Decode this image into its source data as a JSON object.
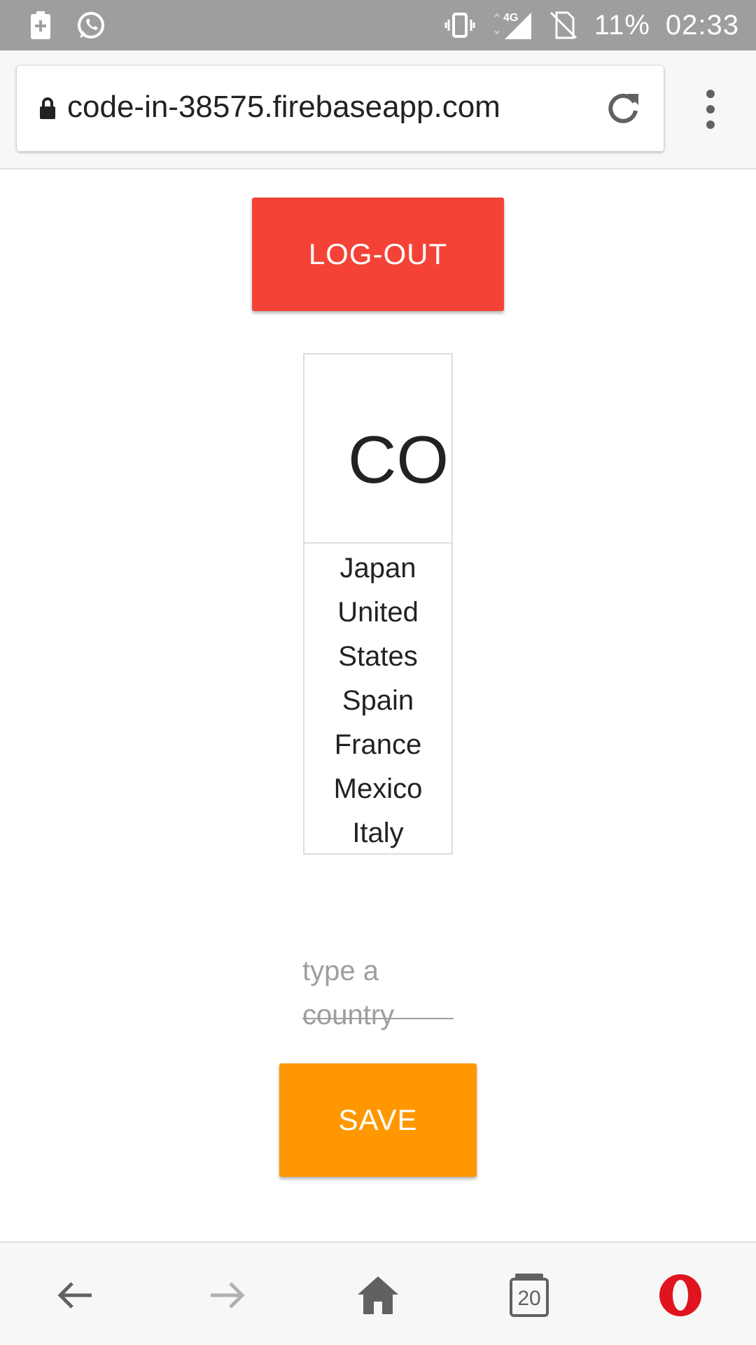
{
  "status_bar": {
    "battery": "11%",
    "time": "02:33",
    "network": "4G"
  },
  "address_bar": {
    "url": "code-in-38575.firebaseapp.com"
  },
  "content": {
    "logout_label": "LOG-OUT",
    "table_header": "COUNTRY",
    "countries": [
      "Japan",
      "United States",
      "Spain",
      "France",
      "Mexico",
      "Italy"
    ],
    "input_placeholder": "type a country",
    "save_label": "SAVE"
  },
  "bottom_nav": {
    "tab_count": "20"
  },
  "colors": {
    "logout": "#f44336",
    "save": "#ff9800",
    "status_bar": "#9e9e9e",
    "opera": "#e0141e"
  }
}
